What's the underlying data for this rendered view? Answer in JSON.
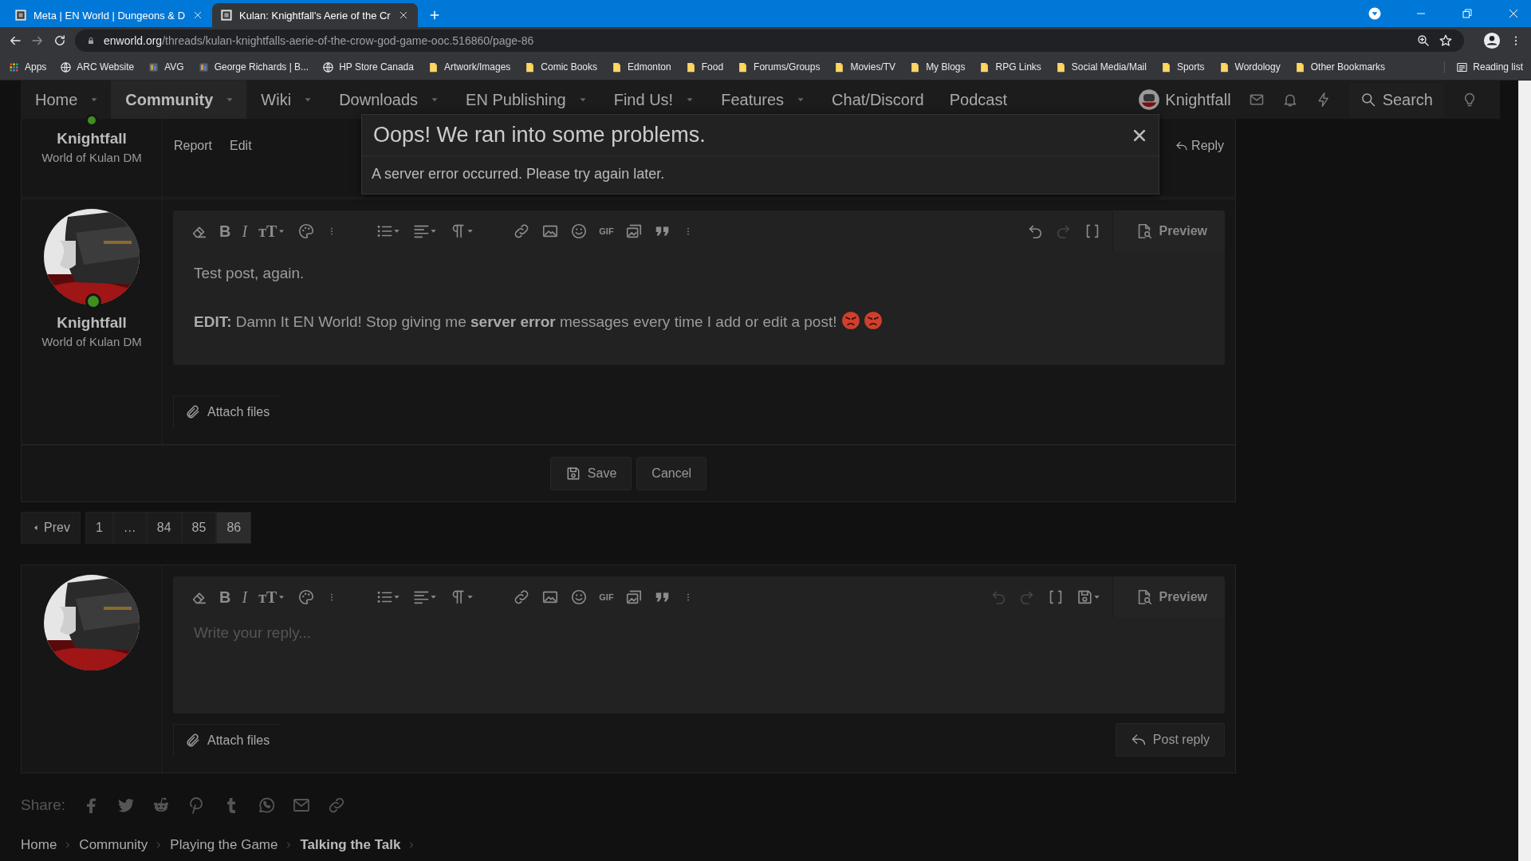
{
  "browser": {
    "tabs": [
      {
        "title": "Meta | EN World | Dungeons & D",
        "selected": false
      },
      {
        "title": "Kulan: Knightfall's Aerie of the Cr",
        "selected": true
      }
    ],
    "address": {
      "domain": "enworld.org",
      "path": "/threads/kulan-knightfalls-aerie-of-the-crow-god-game-ooc.516860/page-86"
    },
    "bookmarks": [
      {
        "label": "Apps",
        "kind": "apps"
      },
      {
        "label": "ARC Website",
        "kind": "globe"
      },
      {
        "label": "AVG",
        "kind": "site"
      },
      {
        "label": "George Richards | B...",
        "kind": "site"
      },
      {
        "label": "HP Store Canada",
        "kind": "globe"
      },
      {
        "label": "Artwork/Images",
        "kind": "folder"
      },
      {
        "label": "Comic Books",
        "kind": "folder"
      },
      {
        "label": "Edmonton",
        "kind": "folder"
      },
      {
        "label": "Food",
        "kind": "folder"
      },
      {
        "label": "Forums/Groups",
        "kind": "folder"
      },
      {
        "label": "Movies/TV",
        "kind": "folder"
      },
      {
        "label": "My Blogs",
        "kind": "folder"
      },
      {
        "label": "RPG Links",
        "kind": "folder"
      },
      {
        "label": "Social Media/Mail",
        "kind": "folder"
      },
      {
        "label": "Sports",
        "kind": "folder"
      },
      {
        "label": "Wordology",
        "kind": "folder"
      },
      {
        "label": "Other Bookmarks",
        "kind": "folder"
      }
    ],
    "reading_list": "Reading list"
  },
  "nav": {
    "items": [
      {
        "label": "Home",
        "selected": false,
        "dropdown": true
      },
      {
        "label": "Community",
        "selected": true,
        "dropdown": true
      },
      {
        "label": "Wiki",
        "selected": false,
        "dropdown": true
      },
      {
        "label": "Downloads",
        "selected": false,
        "dropdown": true
      },
      {
        "label": "EN Publishing",
        "selected": false,
        "dropdown": true
      },
      {
        "label": "Find Us!",
        "selected": false,
        "dropdown": true
      },
      {
        "label": "Features",
        "selected": false,
        "dropdown": true
      },
      {
        "label": "Chat/Discord",
        "selected": false,
        "dropdown": false
      },
      {
        "label": "Podcast",
        "selected": false,
        "dropdown": false
      }
    ],
    "user": "Knightfall",
    "search": "Search"
  },
  "previous_post": {
    "username": "Knightfall",
    "user_title": "World of Kulan DM",
    "online": true,
    "actions": [
      "Report",
      "Edit"
    ],
    "reply": "Reply"
  },
  "modal": {
    "title": "Oops! We ran into some problems.",
    "message": "A server error occurred. Please try again later."
  },
  "edit_form": {
    "toolbar_glyphs": {
      "bold": "B",
      "italic": "I",
      "font_size": "ᴛT",
      "gif": "GIF"
    },
    "username": "Knightfall",
    "user_title": "World of Kulan DM",
    "online": true,
    "undo_enabled": true,
    "drafts_menu": false,
    "paragraphs": [
      "Test post, again.",
      "**EDIT:** Damn It EN World! Stop giving me **server error** messages every time I add or edit a post!"
    ],
    "preview": "Preview",
    "attach": "Attach files",
    "save": "Save",
    "cancel": "Cancel"
  },
  "pagination": {
    "prev": "Prev",
    "pages": [
      {
        "label": "1",
        "selected": false
      },
      {
        "label": "…",
        "selected": false
      },
      {
        "label": "84",
        "selected": false
      },
      {
        "label": "85",
        "selected": false
      },
      {
        "label": "86",
        "selected": true
      }
    ]
  },
  "reply_form": {
    "toolbar_glyphs": {
      "bold": "B",
      "italic": "I",
      "font_size": "ᴛT",
      "gif": "GIF"
    },
    "online": false,
    "undo_enabled": false,
    "drafts_menu": true,
    "placeholder": "Write your reply...",
    "preview": "Preview",
    "attach": "Attach files",
    "post": "Post reply"
  },
  "share": {
    "label": "Share:"
  },
  "breadcrumb": [
    {
      "label": "Home",
      "current": false
    },
    {
      "label": "Community",
      "current": false
    },
    {
      "label": "Playing the Game",
      "current": false
    },
    {
      "label": "Talking the Talk",
      "current": true
    }
  ]
}
